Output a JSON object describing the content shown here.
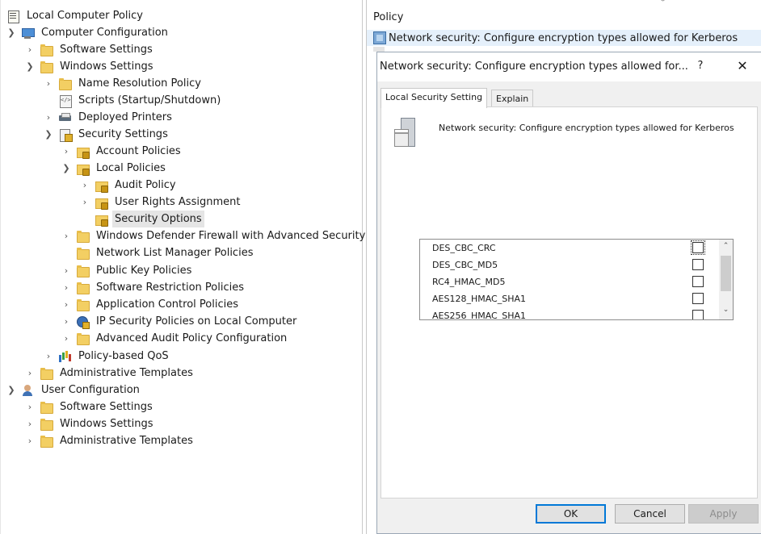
{
  "tree": {
    "nodes": [
      {
        "label": "Local Computer Policy"
      },
      {
        "label": "Computer Configuration"
      },
      {
        "label": "Software Settings"
      },
      {
        "label": "Windows Settings"
      },
      {
        "label": "Name Resolution Policy"
      },
      {
        "label": "Scripts (Startup/Shutdown)"
      },
      {
        "label": "Deployed Printers"
      },
      {
        "label": "Security Settings"
      },
      {
        "label": "Account Policies"
      },
      {
        "label": "Local Policies"
      },
      {
        "label": "Audit Policy"
      },
      {
        "label": "User Rights Assignment"
      },
      {
        "label": "Security Options"
      },
      {
        "label": "Windows Defender Firewall with Advanced Security"
      },
      {
        "label": "Network List Manager Policies"
      },
      {
        "label": "Public Key Policies"
      },
      {
        "label": "Software Restriction Policies"
      },
      {
        "label": "Application Control Policies"
      },
      {
        "label": "IP Security Policies on Local Computer"
      },
      {
        "label": "Advanced Audit Policy Configuration"
      },
      {
        "label": "Policy-based QoS"
      },
      {
        "label": "Administrative Templates"
      },
      {
        "label": "User Configuration"
      },
      {
        "label": "Software Settings"
      },
      {
        "label": "Windows Settings"
      },
      {
        "label": "Administrative Templates"
      }
    ],
    "selected": "Security Options"
  },
  "details": {
    "column_header": "Policy",
    "selected_policy": "Network security: Configure encryption types allowed for Kerberos"
  },
  "dialog": {
    "title": "Network security: Configure encryption types allowed for...",
    "help_label": "?",
    "close_label": "✕",
    "tabs": [
      {
        "label": "Local Security Setting",
        "active": true
      },
      {
        "label": "Explain",
        "active": false
      }
    ],
    "description": "Network security: Configure encryption types allowed for Kerberos",
    "options": [
      {
        "label": "DES_CBC_CRC",
        "checked": false
      },
      {
        "label": "DES_CBC_MD5",
        "checked": false
      },
      {
        "label": "RC4_HMAC_MD5",
        "checked": false
      },
      {
        "label": "AES128_HMAC_SHA1",
        "checked": false
      },
      {
        "label": "AES256_HMAC_SHA1",
        "checked": false
      }
    ],
    "buttons": {
      "ok": "OK",
      "cancel": "Cancel",
      "apply": "Apply"
    }
  },
  "colors": {
    "selection_bg": "#e5e5e5",
    "row_highlight": "#e5f0fb",
    "dialog_bg": "#f0f0f0",
    "ok_border": "#0078d7"
  }
}
